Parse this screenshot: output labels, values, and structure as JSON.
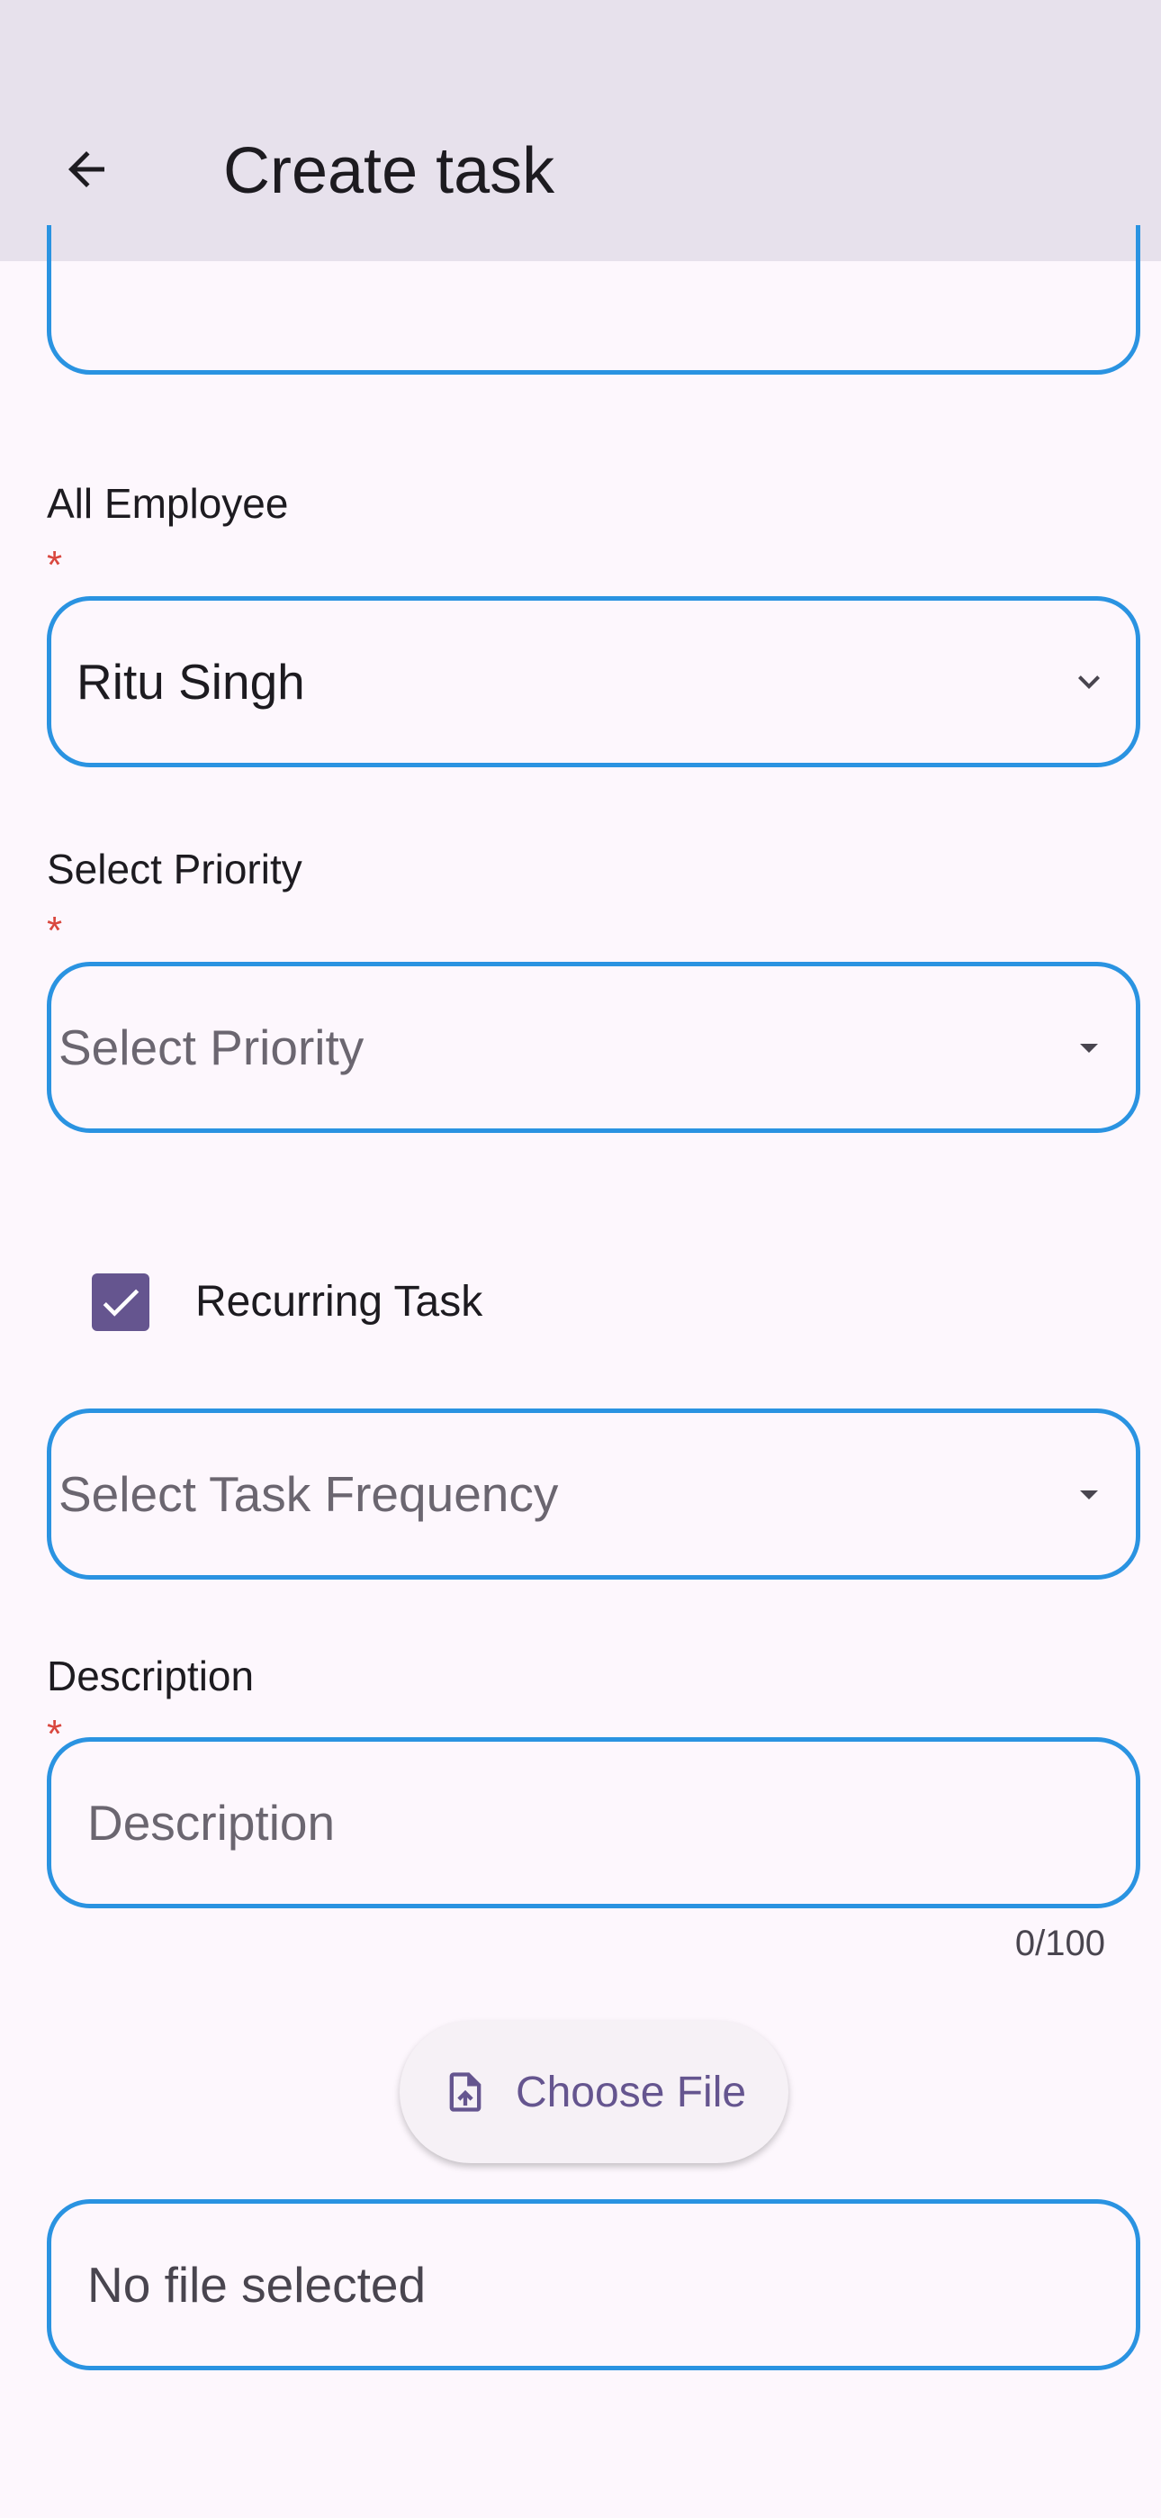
{
  "appbar": {
    "title": "Create task",
    "back_icon": "arrow-back-icon"
  },
  "employee": {
    "label": "All Employee",
    "required_mark": "*",
    "value": "Ritu Singh",
    "icon": "chevron-down-icon"
  },
  "priority": {
    "label": "Select Priority",
    "required_mark": "*",
    "placeholder": "Select Priority",
    "icon": "dropdown-arrow-icon"
  },
  "recurring": {
    "label": "Recurring Task",
    "checked": true
  },
  "frequency": {
    "placeholder": "Select Task Frequency",
    "icon": "dropdown-arrow-icon"
  },
  "description": {
    "label": "Description",
    "required_mark": "*",
    "placeholder": "Description",
    "counter": "0/100"
  },
  "file": {
    "button_label": "Choose File",
    "button_icon": "file-upload-icon",
    "status": "No file selected"
  },
  "colors": {
    "appbar_bg": "#e7e1ec",
    "page_bg": "#fdf7fd",
    "field_border": "#2a93e1",
    "accent": "#65558f",
    "required": "#d9473e"
  }
}
